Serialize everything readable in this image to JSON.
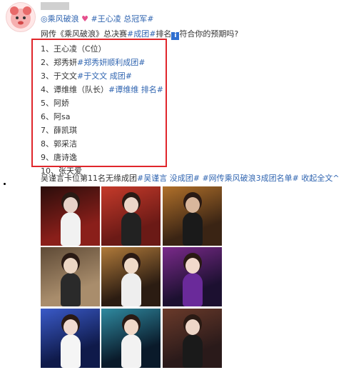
{
  "header": {
    "tagline": [
      {
        "text": "◎乘风破浪",
        "link": true
      },
      {
        "text": " ",
        "link": false
      },
      {
        "text": "♥",
        "link": false,
        "color": "#e5508d"
      },
      {
        "text": " #王心凌 总冠军#",
        "link": true
      }
    ]
  },
  "post": {
    "text_parts": [
      {
        "text": "网传《乘风破浪》总决赛",
        "link": false
      },
      {
        "text": "#成团#",
        "link": true
      },
      {
        "text": "排名",
        "link": false
      },
      {
        "text": "i",
        "icon": true
      },
      {
        "text": "符合你的预期吗?",
        "link": false
      }
    ]
  },
  "ranking": [
    {
      "parts": [
        {
          "text": "1、王心凌（C位）",
          "link": false
        }
      ]
    },
    {
      "parts": [
        {
          "text": "2、郑秀妍",
          "link": false
        },
        {
          "text": "#郑秀妍顺利成团#",
          "link": true
        }
      ]
    },
    {
      "parts": [
        {
          "text": "3、于文文",
          "link": false
        },
        {
          "text": "#于文文 成团#",
          "link": true
        }
      ]
    },
    {
      "parts": [
        {
          "text": "4、谭维维（队长）",
          "link": false
        },
        {
          "text": "#谭维维 排名#",
          "link": true
        }
      ]
    },
    {
      "parts": [
        {
          "text": "5、阿娇",
          "link": false
        }
      ]
    },
    {
      "parts": [
        {
          "text": "6、阿sa",
          "link": false
        }
      ]
    },
    {
      "parts": [
        {
          "text": "7、薛凯琪",
          "link": false
        }
      ]
    },
    {
      "parts": [
        {
          "text": "8、郭采洁",
          "link": false
        }
      ]
    },
    {
      "parts": [
        {
          "text": "9、唐诗逸",
          "link": false
        }
      ]
    },
    {
      "parts": [
        {
          "text": "10、张天爱",
          "link": false
        }
      ]
    }
  ],
  "footer": {
    "parts": [
      {
        "text": "吴谨言卡位第11名无缘成团",
        "link": false
      },
      {
        "text": "#吴谨言 没成团#",
        "link": true
      },
      {
        "text": " ",
        "link": false
      },
      {
        "text": "#网传乘风破浪3成团名单#",
        "link": true
      },
      {
        "text": " ",
        "link": false
      },
      {
        "text": "收起全文^",
        "link": true
      }
    ]
  },
  "photos": [
    {
      "bg": "#8a1f1a",
      "bg2": "#2a0d0b",
      "fig": "#e6d2c8",
      "body": "#f1f1f1"
    },
    {
      "bg": "#6b1a16",
      "bg2": "#c53a2a",
      "fig": "#ecd5c8",
      "body": "#222222"
    },
    {
      "bg": "#3a2414",
      "bg2": "#b0702a",
      "fig": "#d9b79c",
      "body": "#1a1a1a"
    },
    {
      "bg": "#a98d6c",
      "bg2": "#5e4a36",
      "fig": "#ecd6c4",
      "body": "#2a2a2a"
    },
    {
      "bg": "#2b1c12",
      "bg2": "#b07a3a",
      "fig": "#f0dac8",
      "body": "#eeeeee"
    },
    {
      "bg": "#1c1030",
      "bg2": "#7a2a8a",
      "fig": "#f2d9cc",
      "body": "#6a2a9a"
    },
    {
      "bg": "#0f1a4a",
      "bg2": "#3a5ac8",
      "fig": "#f0dad0",
      "body": "#f5f5f5"
    },
    {
      "bg": "#0a1a2a",
      "bg2": "#2f8aa0",
      "fig": "#f0d8c8",
      "body": "#f2f2f2"
    },
    {
      "bg": "#2a1a1a",
      "bg2": "#6a3a2a",
      "fig": "#eed6c8",
      "body": "#1a1a1a"
    }
  ]
}
